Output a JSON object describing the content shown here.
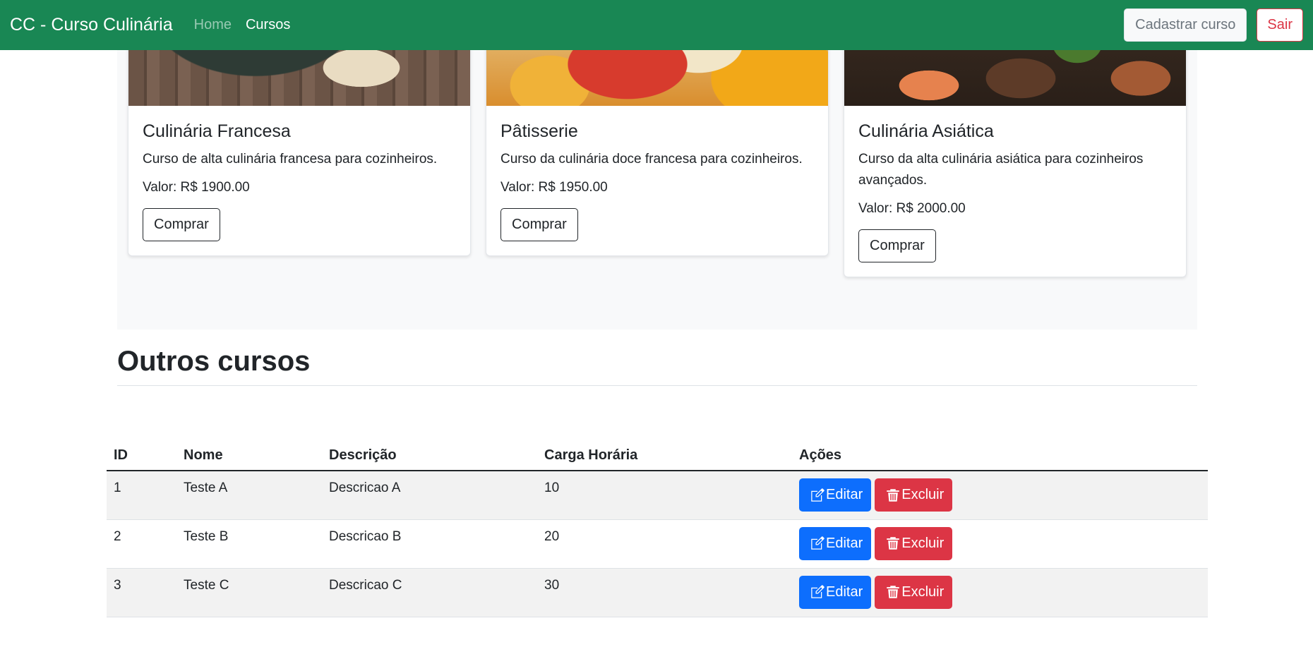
{
  "navbar": {
    "brand": "CC - Curso Culinária",
    "links": [
      {
        "label": "Home"
      },
      {
        "label": "Cursos"
      }
    ],
    "register_course_label": "Cadastrar curso",
    "logout_label": "Sair"
  },
  "featured_courses": [
    {
      "title": "Culinária Francesa",
      "description": "Curso de alta culinária francesa para cozinheiros.",
      "price": "Valor: R$ 1900.00",
      "buy_label": "Comprar",
      "image_icon": "french-dish-image"
    },
    {
      "title": "Pâtisserie",
      "description": "Curso da culinária doce francesa para cozinheiros.",
      "price": "Valor: R$ 1950.00",
      "buy_label": "Comprar",
      "image_icon": "pastry-image"
    },
    {
      "title": "Culinária Asiática",
      "description": "Curso da alta culinária asiática para cozinheiros avançados.",
      "price": "Valor: R$ 2000.00",
      "buy_label": "Comprar",
      "image_icon": "asian-dishes-image"
    }
  ],
  "other_courses": {
    "title": "Outros cursos",
    "columns": [
      "ID",
      "Nome",
      "Descrição",
      "Carga Horária",
      "Ações"
    ],
    "rows": [
      {
        "id": "1",
        "name": "Teste A",
        "description": "Descricao A",
        "hours": "10"
      },
      {
        "id": "2",
        "name": "Teste B",
        "description": "Descricao B",
        "hours": "20"
      },
      {
        "id": "3",
        "name": "Teste C",
        "description": "Descricao C",
        "hours": "30"
      }
    ],
    "edit_label": "Editar",
    "delete_label": "Excluir"
  },
  "colors": {
    "navbar": "#198754",
    "primary": "#0d6efd",
    "danger": "#dc3545",
    "section_bg": "#f8f9fa"
  }
}
